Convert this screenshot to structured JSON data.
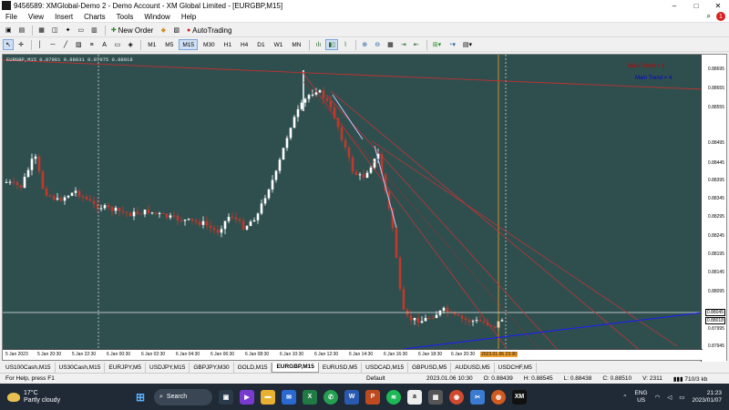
{
  "window": {
    "title": "9456589: XMGlobal-Demo 2 - Demo Account - XM Global Limited - [EURGBP,M15]",
    "minimize": "–",
    "maximize": "□",
    "close": "✕"
  },
  "menu": {
    "items": [
      "File",
      "View",
      "Insert",
      "Charts",
      "Tools",
      "Window",
      "Help"
    ],
    "notification_count": "1"
  },
  "toolbar": {
    "new_order": "New Order",
    "auto_trading": "AutoTrading",
    "timeframes": [
      "M1",
      "M5",
      "M15",
      "M30",
      "H1",
      "H4",
      "D1",
      "W1",
      "MN"
    ],
    "active_timeframe": "M15"
  },
  "chart": {
    "header": "EURGBP,M15  0.87981 0.88031 0.87975 0.88018",
    "legend_red": "Main Trend = 1",
    "legend_blue": "Main Trend = 4",
    "price_labels": [
      "0.88695",
      "0.88655",
      "0.88555",
      "0.88495",
      "0.88445",
      "0.88395",
      "0.88345",
      "0.88295",
      "0.88245",
      "0.88195",
      "0.88145",
      "0.88095",
      "0.88045",
      "0.88018",
      "0.87995",
      "0.87945"
    ],
    "time_labels": [
      "5 Jan 2023",
      "5 Jan 20:30",
      "5 Jan 22:30",
      "6 Jan 00:30",
      "6 Jan 02:30",
      "6 Jan 04:30",
      "6 Jan 06:30",
      "6 Jan 08:30",
      "6 Jan 10:30",
      "6 Jan 12:30",
      "6 Jan 14:30",
      "6 Jan 16:30",
      "6 Jan 18:30",
      "6 Jan 20:30",
      "2023.01.06 23:30"
    ],
    "current_price": "0.88041",
    "bid_price": "0.88018",
    "colors": {
      "bg": "#2f4f4f",
      "bull": "#ffffff",
      "bear": "#c0392b",
      "trend_red": "#d03030",
      "trend_blue": "#1a1aff"
    }
  },
  "tabs": {
    "items": [
      "US100Cash,M15",
      "US30Cash,M15",
      "EURJPY,M5",
      "USDJPY,M15",
      "GBPJPY,M30",
      "GOLD,M15",
      "EURGBP,M15",
      "EURUSD,M5",
      "USDCAD,M15",
      "GBPUSD,M5",
      "AUDUSD,M5",
      "USDCHF,M5"
    ],
    "active": "EURGBP,M15"
  },
  "status": {
    "help": "For Help, press F1",
    "profile": "Default",
    "datetime": "2023.01.06 10:30",
    "open": "O: 0.88439",
    "high": "H: 0.88545",
    "low": "L: 0.88438",
    "close": "C: 0.88510",
    "volume": "V: 2311",
    "traffic": "710/3 kb"
  },
  "taskbar": {
    "temperature": "17°C",
    "weather": "Partly cloudy",
    "search": "Search",
    "lang1": "ENG",
    "lang2": "US",
    "time": "21:23",
    "date": "2023/01/07"
  }
}
